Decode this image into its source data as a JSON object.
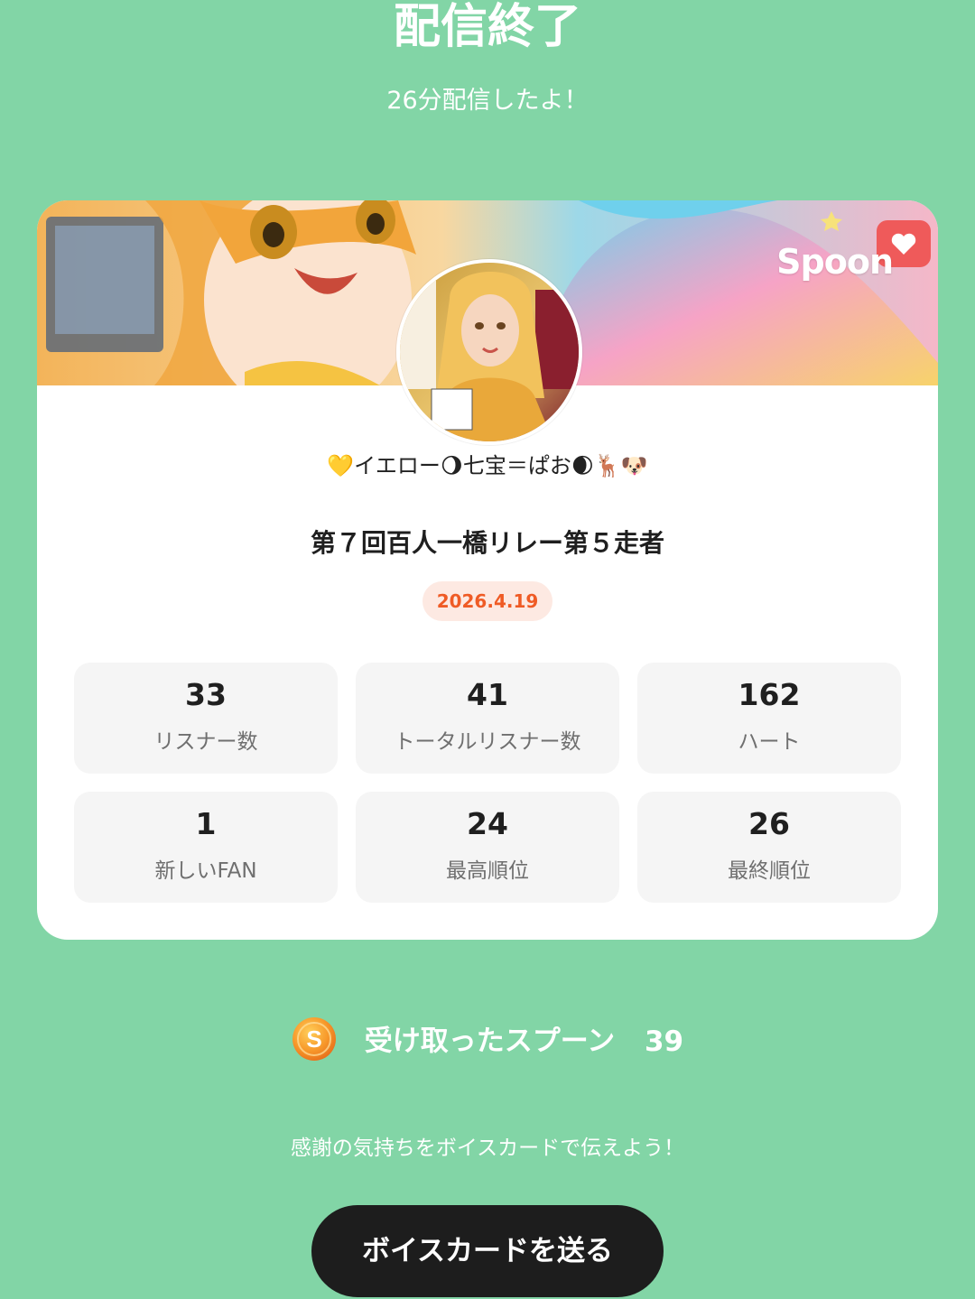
{
  "header": {
    "title": "配信終了",
    "duration_text": "26分配信したよ！"
  },
  "card": {
    "brand_logo": "Spoon",
    "host_name": "💛イエロー🌖七宝＝ぱお🌒🦌🐶",
    "broadcast_title": "第７回百人一橋リレー第５走者",
    "date": "2026.4.19",
    "stats": [
      {
        "value": "33",
        "label": "リスナー数"
      },
      {
        "value": "41",
        "label": "トータルリスナー数"
      },
      {
        "value": "162",
        "label": "ハート"
      },
      {
        "value": "1",
        "label": "新しいFAN"
      },
      {
        "value": "24",
        "label": "最高順位"
      },
      {
        "value": "26",
        "label": "最終順位"
      }
    ]
  },
  "spoons": {
    "icon": "spoon-coin-icon",
    "label": "受け取ったスプーン",
    "count": "39"
  },
  "message": "感謝の気持ちをボイスカードで伝えよう！",
  "send_button_label": "ボイスカードを送る",
  "colors": {
    "background": "#82d5a6",
    "date_badge_text": "#ef5b25",
    "date_badge_bg": "#fde9e2",
    "button_bg": "#1d1d1d"
  }
}
